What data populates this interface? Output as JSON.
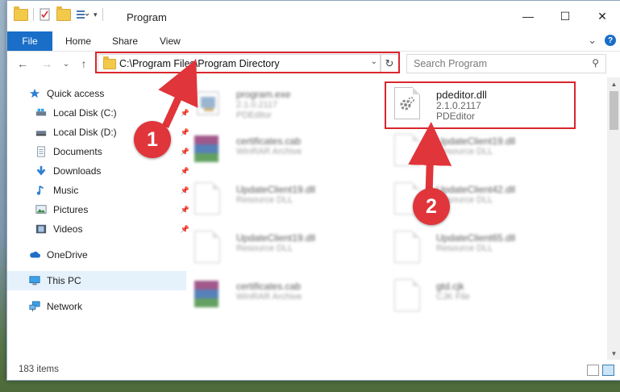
{
  "window": {
    "title": "Program",
    "minimize": "—",
    "maximize": "☐",
    "close": "✕"
  },
  "ribbon": {
    "tabs": [
      "File",
      "Home",
      "Share",
      "View"
    ],
    "expand": "⌄",
    "help": "?"
  },
  "nav": {
    "back": "←",
    "forward": "→",
    "recent": "⌄",
    "up": "↑",
    "address": "C:\\Program Files\\Program Directory",
    "address_drop": "⌄",
    "refresh": "↻",
    "search_placeholder": "Search Program",
    "search_icon": "⚲"
  },
  "sidebar": {
    "items": [
      {
        "label": "Quick access",
        "icon": "star-icon",
        "pinned": false
      },
      {
        "label": "Local Disk (C:)",
        "icon": "drive-icon",
        "pinned": true
      },
      {
        "label": "Local Disk (D:)",
        "icon": "drive-icon",
        "pinned": true
      },
      {
        "label": "Documents",
        "icon": "documents-icon",
        "pinned": true
      },
      {
        "label": "Downloads",
        "icon": "download-icon",
        "pinned": true
      },
      {
        "label": "Music",
        "icon": "music-icon",
        "pinned": true
      },
      {
        "label": "Pictures",
        "icon": "pictures-icon",
        "pinned": true
      },
      {
        "label": "Videos",
        "icon": "videos-icon",
        "pinned": true
      },
      {
        "label": "OneDrive",
        "icon": "cloud-icon",
        "pinned": false
      },
      {
        "label": "This PC",
        "icon": "computer-icon",
        "pinned": false
      },
      {
        "label": "Network",
        "icon": "network-icon",
        "pinned": false
      }
    ],
    "pin_glyph": "📌"
  },
  "files": [
    {
      "name": "program.exe",
      "line1": "2.1.0.2117",
      "line2": "PDEditor"
    },
    {
      "name": "pdeditor.dll",
      "line1": "2.1.0.2117",
      "line2": "PDEditor"
    },
    {
      "name": "certificates.cab",
      "line1": "WinRAR Archive",
      "line2": ""
    },
    {
      "name": "UpdateClient19.dll",
      "line1": "Resource DLL",
      "line2": ""
    },
    {
      "name": "UpdateClient19.dll",
      "line1": "Resource DLL",
      "line2": ""
    },
    {
      "name": "UpdateClient42.dll",
      "line1": "Resource DLL",
      "line2": ""
    },
    {
      "name": "UpdateClient19.dll",
      "line1": "Resource DLL",
      "line2": ""
    },
    {
      "name": "UpdateClient65.dll",
      "line1": "Resource DLL",
      "line2": ""
    },
    {
      "name": "certificates.cab",
      "line1": "WinRAR Archive",
      "line2": ""
    },
    {
      "name": "gtd.cjk",
      "line1": "CJK File",
      "line2": ""
    }
  ],
  "status": {
    "items": "183 items"
  },
  "annotations": {
    "step1": "1",
    "step2": "2"
  },
  "colors": {
    "accent": "#1a6ec8",
    "highlight_red": "#d9262d",
    "marker_red": "#e0353a"
  }
}
